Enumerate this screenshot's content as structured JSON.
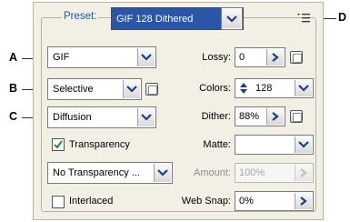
{
  "preset": {
    "label": "Preset:",
    "value": "GIF 128 Dithered"
  },
  "callouts": {
    "a": "A",
    "b": "B",
    "c": "C",
    "d": "D"
  },
  "format": {
    "value": "GIF"
  },
  "reduction": {
    "value": "Selective"
  },
  "dither_algo": {
    "value": "Diffusion"
  },
  "transparency": {
    "label": "Transparency",
    "checked": true
  },
  "transparency_dither": {
    "value": "No Transparency ..."
  },
  "interlaced": {
    "label": "Interlaced",
    "checked": false
  },
  "lossy": {
    "label": "Lossy:",
    "value": "0"
  },
  "colors": {
    "label": "Colors:",
    "value": "128"
  },
  "dither": {
    "label": "Dither:",
    "value": "88%"
  },
  "matte": {
    "label": "Matte:",
    "value": ""
  },
  "amount": {
    "label": "Amount:",
    "value": "100%"
  },
  "websnap": {
    "label": "Web Snap:",
    "value": "0%"
  },
  "colors_ui": {
    "panel_bg": "#f2efe4",
    "preset_label": "#1f5aa8",
    "selected_bg": "#2b56a8"
  }
}
